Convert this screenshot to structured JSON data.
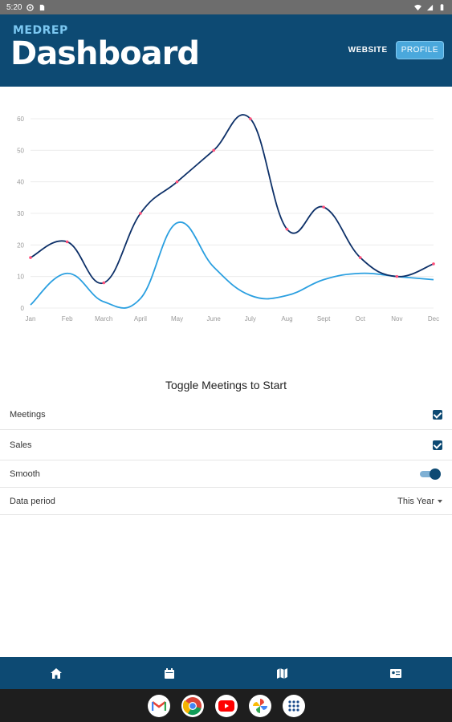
{
  "status_bar": {
    "time": "5:20"
  },
  "header": {
    "brand_small": "MEDREP",
    "brand_big": "Dashboard",
    "website_label": "WEBSITE",
    "profile_label": "PROFILE"
  },
  "chart_data": {
    "type": "line",
    "categories": [
      "Jan",
      "Feb",
      "March",
      "April",
      "May",
      "June",
      "July",
      "Aug",
      "Sept",
      "Oct",
      "Nov",
      "Dec"
    ],
    "series": [
      {
        "values": [
          16,
          21,
          8,
          30,
          40,
          50,
          60,
          25,
          32,
          16,
          10,
          14
        ],
        "color": "#0d3068",
        "markers": true
      },
      {
        "values": [
          1,
          11,
          2,
          3,
          27,
          13,
          4,
          4,
          9,
          11,
          10,
          9
        ],
        "color": "#2a9fe0",
        "markers": false
      }
    ],
    "yticks": [
      0,
      10,
      20,
      30,
      40,
      50,
      60
    ],
    "ylim": [
      0,
      60
    ],
    "grid": true,
    "smooth": true,
    "marker_color": "#ff4f7a"
  },
  "settings": {
    "title": "Toggle Meetings to Start",
    "meetings_label": "Meetings",
    "sales_label": "Sales",
    "smooth_label": "Smooth",
    "period_label": "Data period",
    "period_value": "This Year"
  },
  "nav": {
    "items": [
      "home-icon",
      "calendar-icon",
      "map-icon",
      "badge-icon"
    ]
  },
  "dock": {
    "apps": [
      "gmail-icon",
      "chrome-icon",
      "youtube-icon",
      "photos-icon",
      "apps-grid-icon"
    ]
  }
}
